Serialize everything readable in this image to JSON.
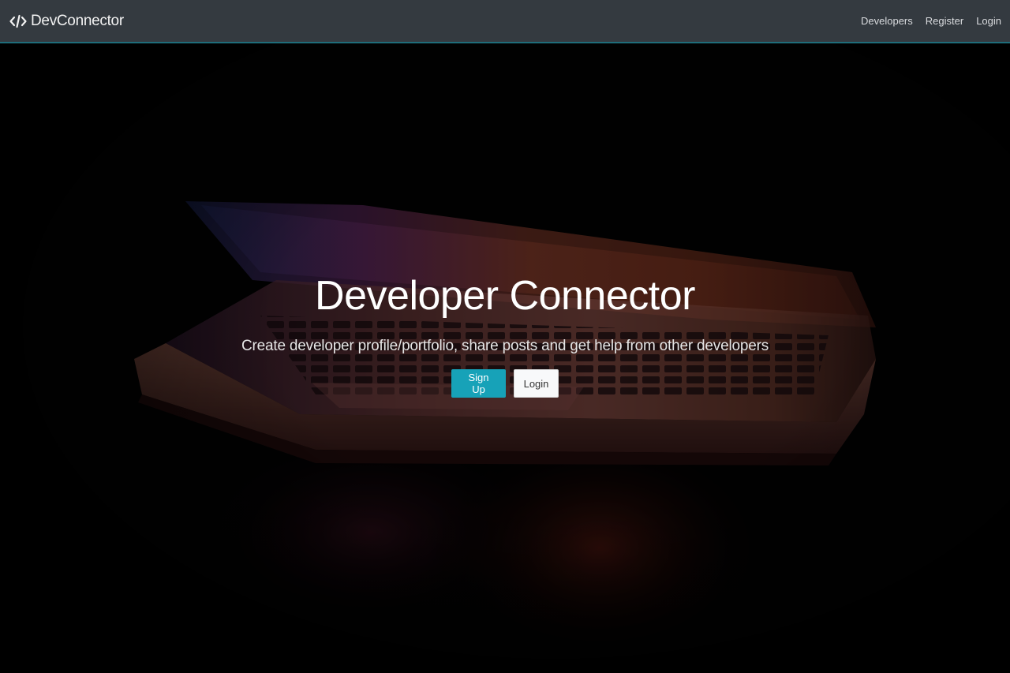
{
  "navbar": {
    "brand_icon": "code-icon",
    "brand_text": "DevConnector",
    "links": [
      {
        "label": "Developers"
      },
      {
        "label": "Register"
      },
      {
        "label": "Login"
      }
    ],
    "background_color": "#343a40"
  },
  "hero": {
    "title": "Developer Connector",
    "lead": "Create developer profile/portfolio, share posts and get help from other developers",
    "signup_label": "Sign Up",
    "login_label": "Login",
    "signup_color": "#17a2b8",
    "login_color": "#f8f9fa"
  }
}
